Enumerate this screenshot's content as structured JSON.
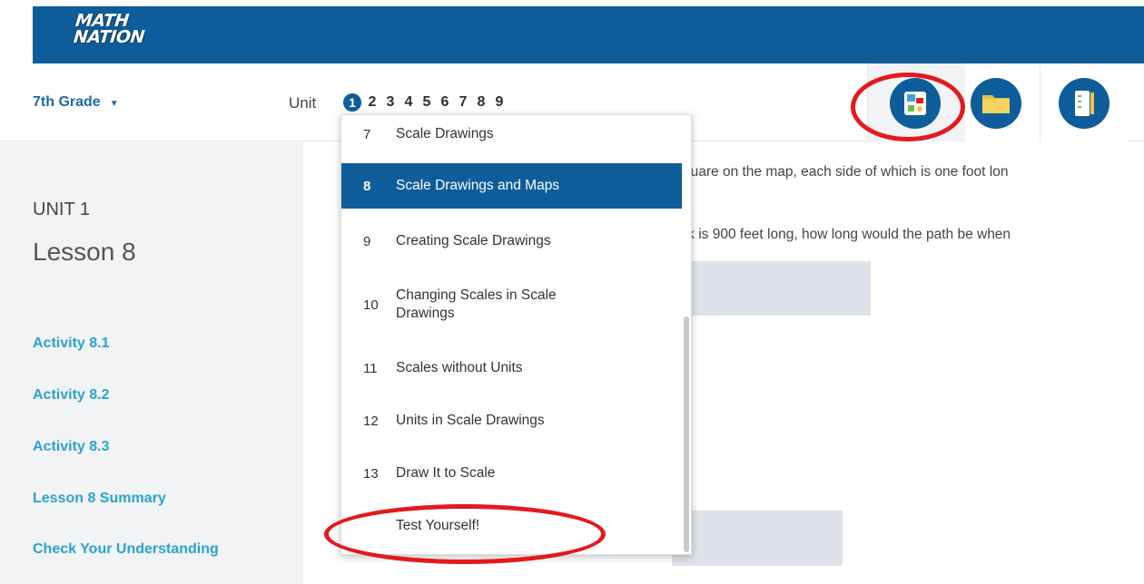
{
  "brand": {
    "logo_line1": "MATH",
    "logo_line2": "NATION"
  },
  "grade_selector": {
    "label": "7th Grade",
    "caret": "▼"
  },
  "unit_nav": {
    "label": "Unit",
    "units": [
      "1",
      "2",
      "3",
      "4",
      "5",
      "6",
      "7",
      "8",
      "9"
    ],
    "active": "1"
  },
  "toolbar": {
    "icons": [
      "workspace-icon",
      "folder-icon",
      "notebook-icon"
    ]
  },
  "sidebar": {
    "unit_heading": "UNIT 1",
    "lesson_heading": "Lesson 8",
    "links": [
      "Activity 8.1",
      "Activity 8.2",
      "Activity 8.3",
      "Lesson 8 Summary",
      "Check Your Understanding"
    ]
  },
  "main": {
    "line1": "quare on the map, each side of which is one foot lon",
    "line2": "rk is 900 feet long, how long would the path be when"
  },
  "lesson_dropdown": {
    "items": [
      {
        "num": "7",
        "label": "Scale Drawings"
      },
      {
        "num": "8",
        "label": "Scale Drawings and Maps",
        "active": true
      },
      {
        "num": "9",
        "label": "Creating Scale Drawings"
      },
      {
        "num": "10",
        "label": "Changing Scales in Scale Drawings"
      },
      {
        "num": "11",
        "label": "Scales without Units"
      },
      {
        "num": "12",
        "label": "Units in Scale Drawings"
      },
      {
        "num": "13",
        "label": "Draw It to Scale"
      },
      {
        "num": "",
        "label": "Test Yourself!"
      }
    ]
  },
  "colors": {
    "header": "#0e5d9a",
    "link": "#2aa3d0",
    "annotation": "#e3191e"
  }
}
